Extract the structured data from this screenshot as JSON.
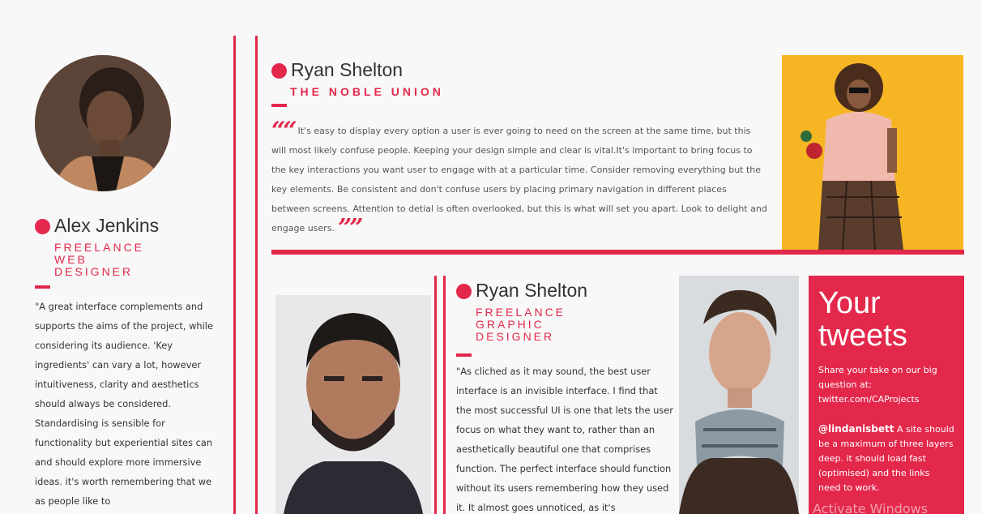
{
  "colors": {
    "accent": "#e3284b",
    "background": "#f8f8f8",
    "text": "#333333"
  },
  "left_profile": {
    "name": "Alex Jenkins",
    "role_lines": [
      "FREELANCE",
      "WEB",
      "DESIGNER"
    ],
    "quote": "\"A great interface complements and supports the aims of the project, while considering its audience. 'Key ingredients' can vary a lot, however intuitiveness, clarity and aesthetics should always be considered. Standardising is sensible for functionality but experiential sites can and should explore more immersive ideas. it's worth remembering that we as people like to"
  },
  "feature_profile": {
    "name": "Ryan Shelton",
    "company": "THE NOBLE UNION",
    "quote_open": "““",
    "quote": "It's easy to display every option a user is ever going to need on the screen at the same time, but this will most likely confuse people. Keeping your design simple and clear is vital.It's important to bring focus to the key interactions you want user to engage with at a particular time. Consider removing everything but the key elements. Be consistent and don't confuse users by placing primary navigation in different places between screens. Attention to detial is often overlooked, but this is what will set you apart. Look to delight and engage users.",
    "quote_close": "””"
  },
  "second_profile": {
    "name": "Ryan Shelton",
    "role_lines": [
      "FREELANCE",
      "GRAPHIC",
      "DESIGNER"
    ],
    "quote": "\"As cliched as it may sound, the best user interface is an invisible interface. I find that the most successful UI is one that lets the user focus on what they want to, rather than an aesthetically beautiful one that comprises function. The perfect interface should function without its users remembering how they used it. It almost goes unnoticed, as it's"
  },
  "tweets": {
    "title_line1": "Your",
    "title_line2": "tweets",
    "prompt": "Share your take on our big question at: twitter.com/CAProjects",
    "handle": "@lindanisbett",
    "tweet": " A site should be a maximum of three layers deep. it should load fast (optimised) and the links need to work."
  },
  "watermark": "Activate Windows"
}
